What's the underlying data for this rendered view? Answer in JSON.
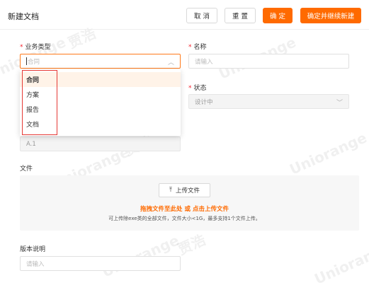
{
  "header": {
    "title": "新建文档",
    "cancel_label": "取 消",
    "reset_label": "重 置",
    "confirm_label": "确 定",
    "confirm_continue_label": "确定并继续新建"
  },
  "form": {
    "business_type": {
      "label": "业务类型",
      "placeholder": "合同",
      "options": [
        "合同",
        "方案",
        "报告",
        "文档"
      ]
    },
    "name": {
      "label": "名称",
      "placeholder": "请输入"
    },
    "status": {
      "label": "状态",
      "value": "设计中"
    },
    "version": {
      "value": "A.1"
    },
    "file": {
      "label": "文件",
      "upload_button": "上传文件",
      "drag_text": "拖拽文件至此处 或 点击上传文件",
      "hint": "可上传除exe类的全部文件，文件大小<1G，最多支持1个文件上传。"
    },
    "version_note": {
      "label": "版本说明",
      "placeholder": "请输入"
    }
  },
  "watermark": {
    "brand": "Uniorange",
    "name": "贾浩"
  },
  "colors": {
    "accent": "#ff6a00",
    "required": "#f5222d",
    "highlight_box": "#e53935"
  }
}
